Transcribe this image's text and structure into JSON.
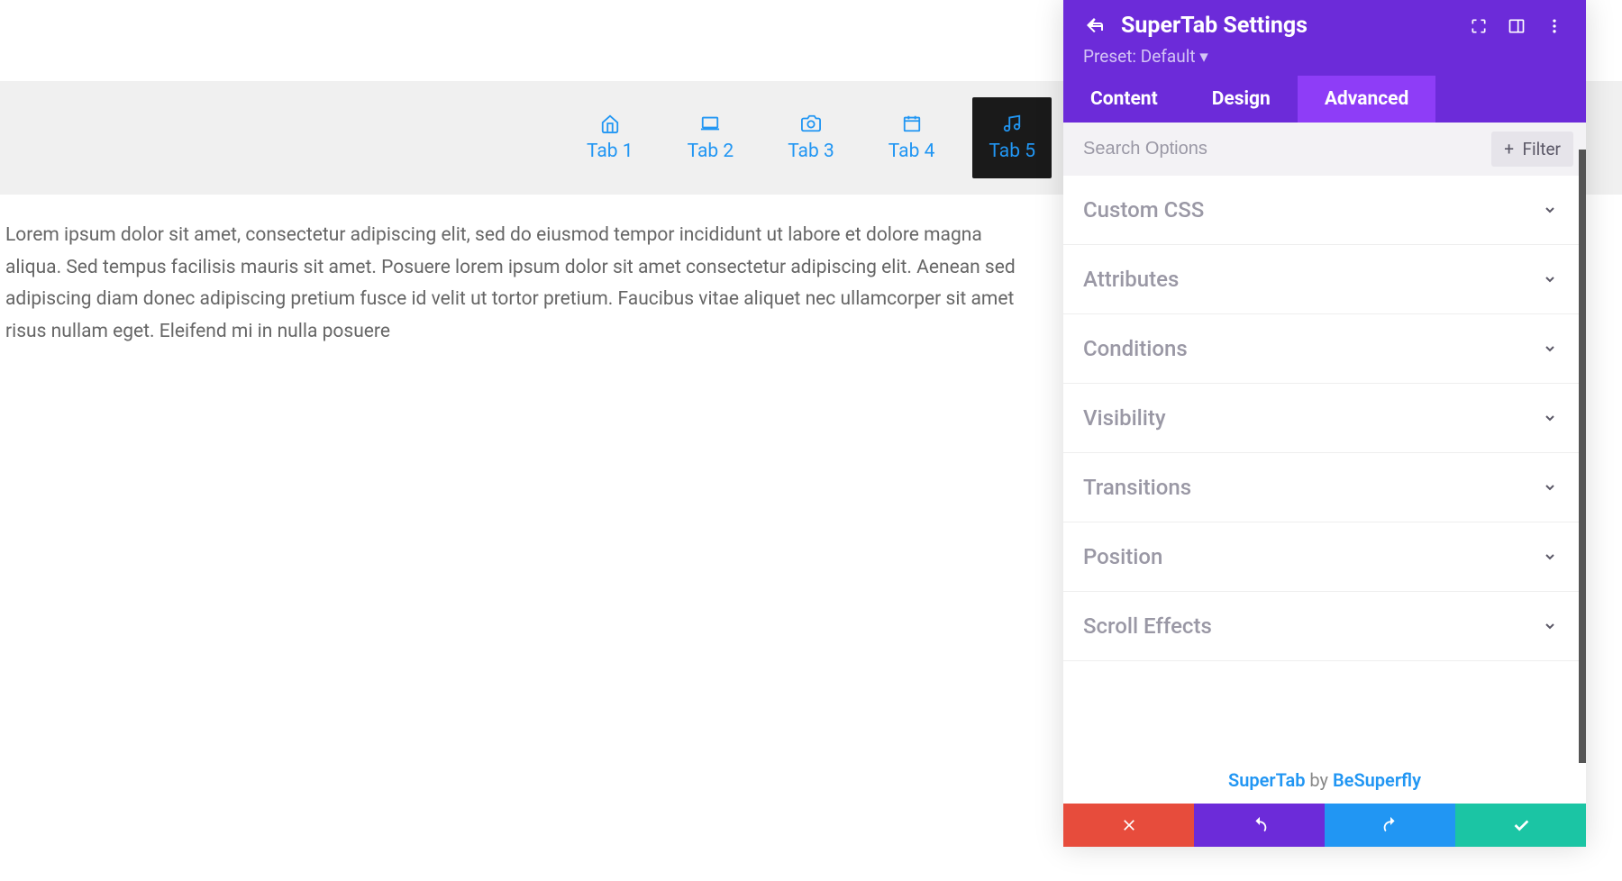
{
  "tabs": [
    {
      "label": "Tab 1",
      "icon": "home"
    },
    {
      "label": "Tab 2",
      "icon": "laptop"
    },
    {
      "label": "Tab 3",
      "icon": "camera"
    },
    {
      "label": "Tab 4",
      "icon": "calendar"
    },
    {
      "label": "Tab 5",
      "icon": "music"
    }
  ],
  "content_text": "Lorem ipsum dolor sit amet, consectetur adipiscing elit, sed do eiusmod tempor incididunt ut labore et dolore magna aliqua. Sed tempus facilisis mauris sit amet. Posuere lorem ipsum dolor sit amet consectetur adipiscing elit. Aenean sed adipiscing diam donec adipiscing pretium fusce id velit ut tortor pretium. Faucibus vitae aliquet nec ullamcorper sit amet risus nullam eget. Eleifend mi in nulla posuere",
  "panel": {
    "title": "SuperTab Settings",
    "preset_label": "Preset: Default",
    "tabs": [
      {
        "label": "Content"
      },
      {
        "label": "Design"
      },
      {
        "label": "Advanced"
      }
    ],
    "search_placeholder": "Search Options",
    "filter_label": "Filter",
    "sections": [
      {
        "label": "Custom CSS"
      },
      {
        "label": "Attributes"
      },
      {
        "label": "Conditions"
      },
      {
        "label": "Visibility"
      },
      {
        "label": "Transitions"
      },
      {
        "label": "Position"
      },
      {
        "label": "Scroll Effects"
      }
    ],
    "credit": {
      "product": "SuperTab",
      "by": " by ",
      "author": "BeSuperfly"
    }
  }
}
